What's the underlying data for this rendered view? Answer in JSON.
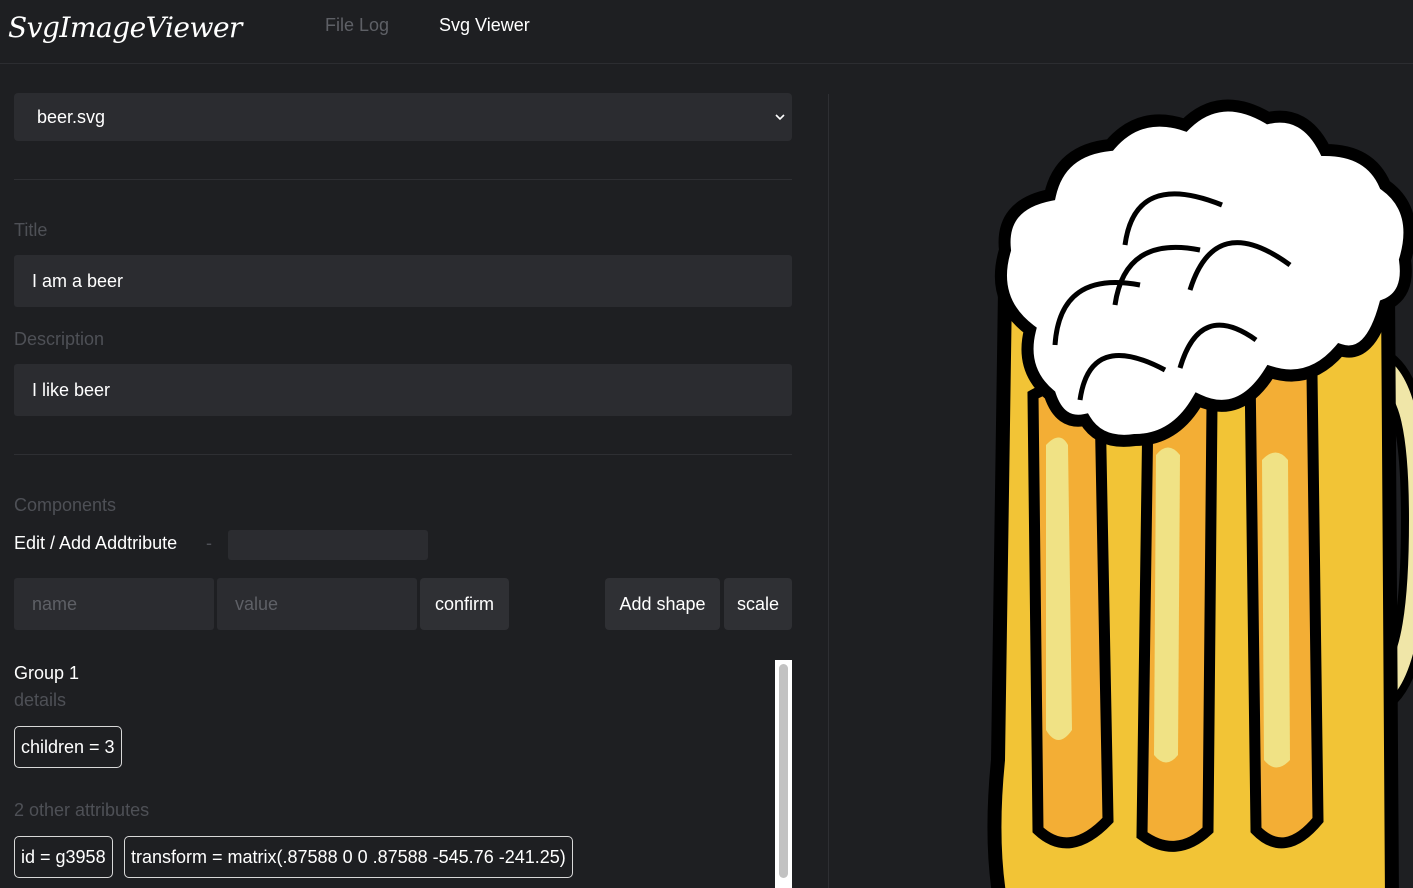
{
  "app": {
    "brand": "SvgImageViewer",
    "nav": [
      "File Log",
      "Svg Viewer"
    ]
  },
  "file_select": {
    "selected": "beer.svg"
  },
  "form": {
    "title_label": "Title",
    "title_value": "I am a beer",
    "description_label": "Description",
    "description_value": "I like beer"
  },
  "components": {
    "heading": "Components",
    "edit_label": "Edit / Add Addtribute",
    "dash": "-",
    "name_placeholder": "name",
    "value_placeholder": "value",
    "confirm_label": "confirm",
    "add_shape_label": "Add shape",
    "scale_label": "scale"
  },
  "group": {
    "title": "Group 1",
    "details_label": "details",
    "children_chip": "children = 3",
    "other_attrs_label": "2 other attributes",
    "attributes": [
      "id = g3958",
      "transform = matrix(.87588 0 0 .87588 -545.76 -241.25)"
    ]
  },
  "colors": {
    "background": "#1e1f22",
    "field": "#2b2c30",
    "muted_text": "#4e5056",
    "beer_yellow": "#f2c436",
    "beer_orange": "#f3ae35",
    "beer_highlight": "#f0e285"
  },
  "preview": {
    "image_name": "beer-mug-image"
  }
}
